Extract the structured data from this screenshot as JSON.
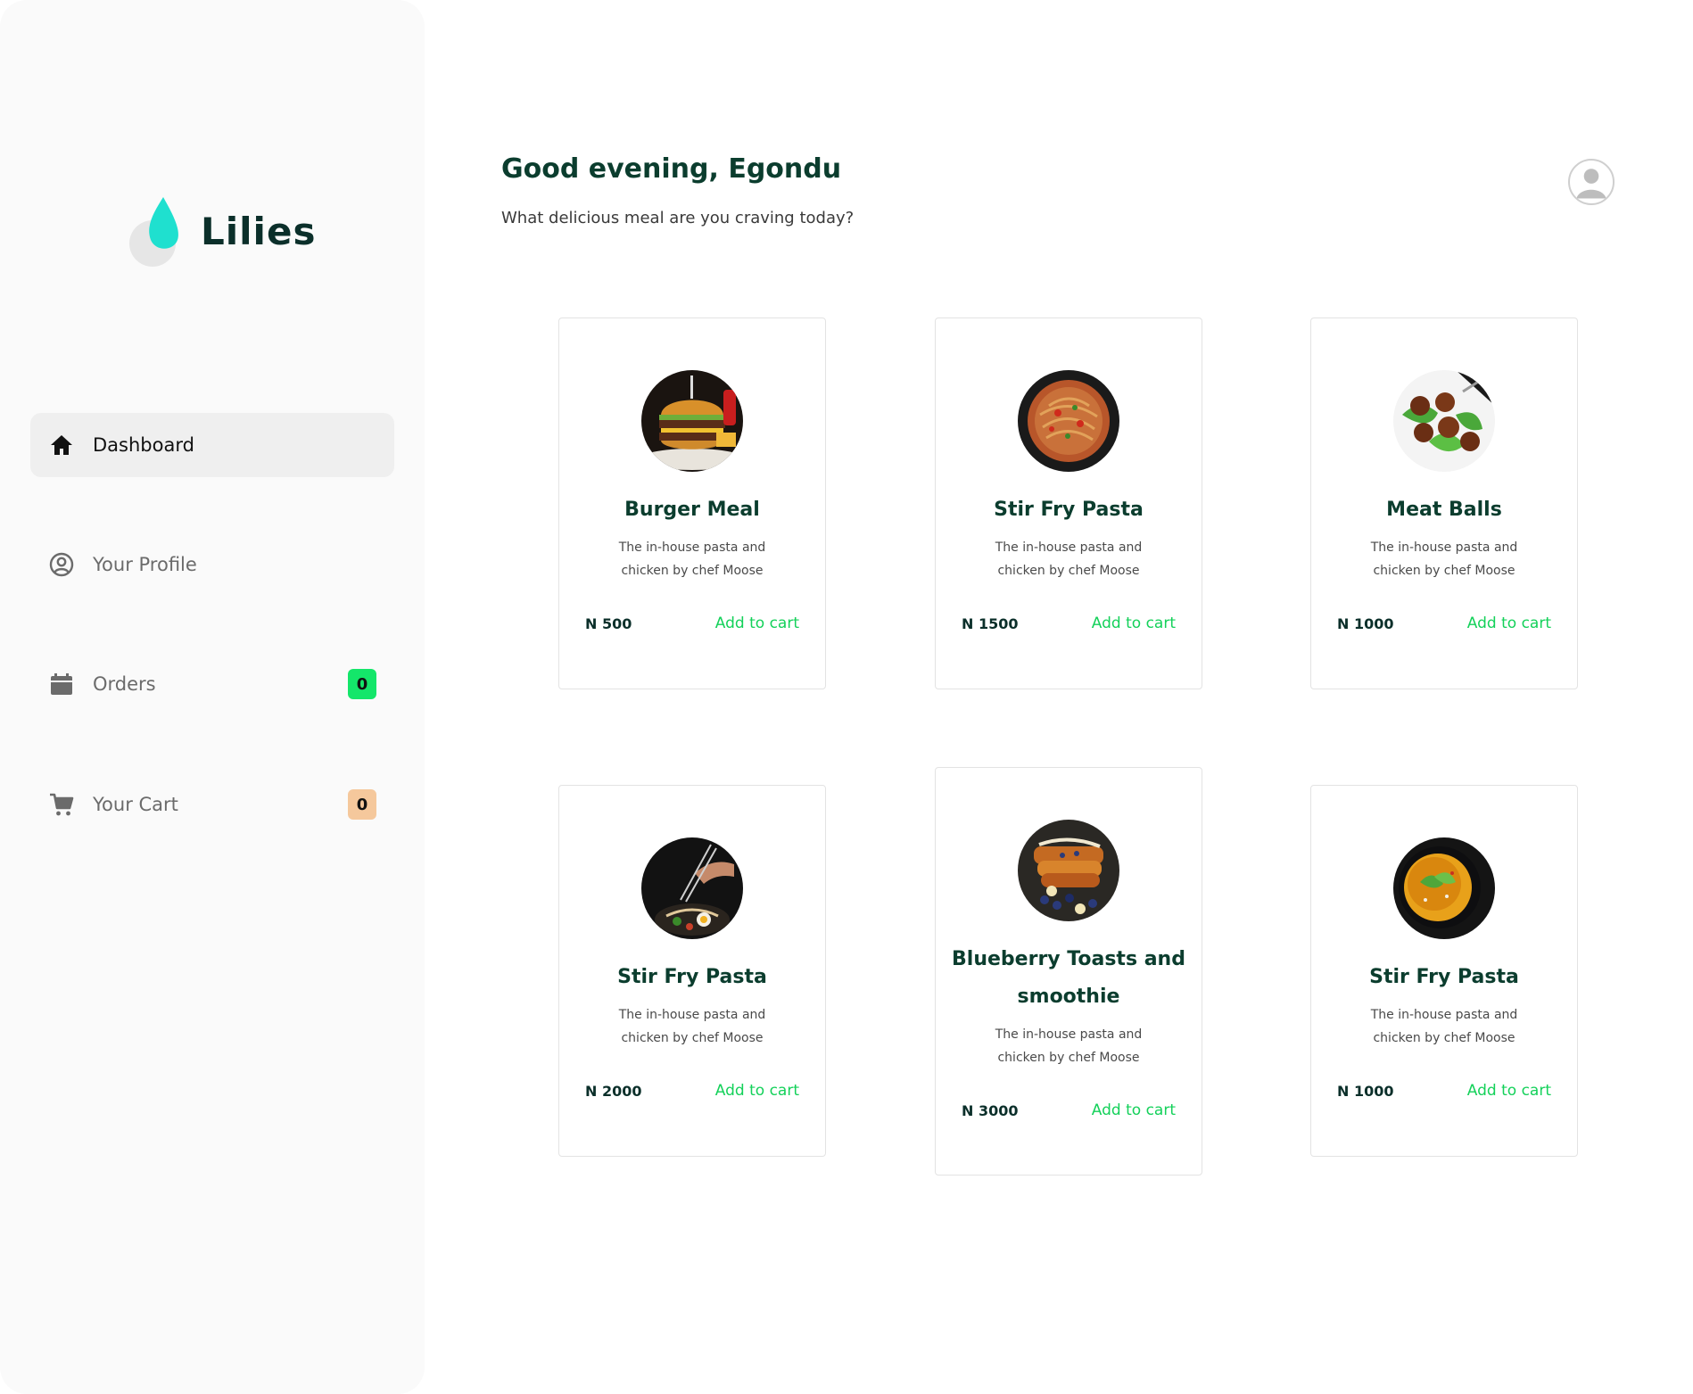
{
  "brand": {
    "name": "Lilies",
    "accent": "#1fe0cf"
  },
  "sidebar": {
    "items": [
      {
        "label": "Dashboard",
        "icon": "home-icon",
        "active": true
      },
      {
        "label": "Your Profile",
        "icon": "user-circle-icon"
      },
      {
        "label": "Orders",
        "icon": "calendar-icon",
        "badge": "0",
        "badge_color": "#14e66a"
      },
      {
        "label": "Your Cart",
        "icon": "cart-icon",
        "badge": "0",
        "badge_color": "#f5c89c"
      }
    ]
  },
  "header": {
    "greeting": "Good evening, Egondu",
    "subtitle": "What delicious meal are you craving today?"
  },
  "meals": [
    {
      "name": "Burger Meal",
      "description": "The in-house pasta and chicken by chef Moose",
      "price": "N 500",
      "action": "Add to cart",
      "image": "burger-image"
    },
    {
      "name": "Stir Fry Pasta",
      "description": "The in-house pasta and chicken by chef Moose",
      "price": "N 1500",
      "action": "Add to cart",
      "image": "pasta-image"
    },
    {
      "name": "Meat Balls",
      "description": "The in-house pasta and chicken by chef Moose",
      "price": "N 1000",
      "action": "Add to cart",
      "image": "meatballs-image"
    },
    {
      "name": "Stir Fry Pasta",
      "description": "The in-house pasta and chicken by chef Moose",
      "price": "N 2000",
      "action": "Add to cart",
      "image": "noodle-bowl-image"
    },
    {
      "name": "Blueberry Toasts and smoothie",
      "description": "The in-house pasta and chicken by chef Moose",
      "price": "N 3000",
      "action": "Add to cart",
      "image": "blueberry-toast-image"
    },
    {
      "name": "Stir Fry Pasta",
      "description": "The in-house pasta and chicken by chef Moose",
      "price": "N 1000",
      "action": "Add to cart",
      "image": "soup-image"
    }
  ],
  "colors": {
    "add_to_cart": "#14d15a",
    "heading": "#0b3d2e",
    "sidebar_bg": "#fafafa"
  }
}
